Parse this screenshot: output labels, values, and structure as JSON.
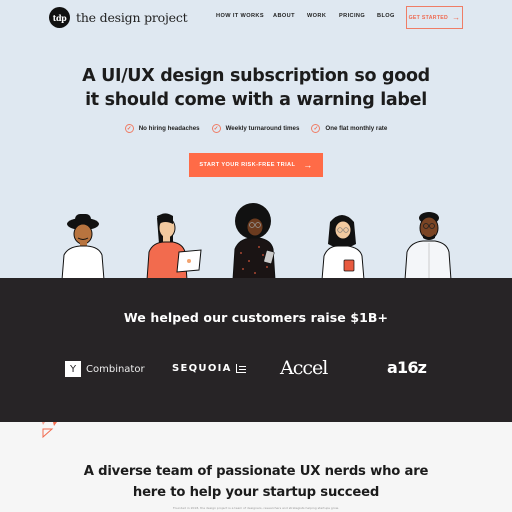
{
  "header": {
    "logo_mark": "tdp",
    "logo_text": "the design project",
    "nav": [
      "HOW IT WORKS",
      "ABOUT",
      "WORK",
      "PRICING",
      "BLOG"
    ],
    "cta_label": "GET STARTED",
    "cta_icon": "arrow-right-icon"
  },
  "hero": {
    "headline_line1": "A UI/UX design subscription so good",
    "headline_line2": "it should come with a warning label",
    "features": [
      "No hiring headaches",
      "Weekly turnaround times",
      "One flat monthly rate"
    ],
    "feature_icon": "check-circle-icon",
    "trial_label": "START YOUR RISK-FREE TRIAL",
    "trial_icon": "arrow-right-icon"
  },
  "social_proof": {
    "title": "We helped our customers raise $1B+",
    "logos": [
      {
        "name": "Y Combinator",
        "mark": "Y",
        "text": "Combinator"
      },
      {
        "name": "Sequoia",
        "text": "SEQUOIA"
      },
      {
        "name": "Accel",
        "text": "Accel"
      },
      {
        "name": "a16z",
        "text": "a16z"
      }
    ]
  },
  "team": {
    "title_line1": "A diverse team of passionate UX nerds who are",
    "title_line2": "here to help your startup succeed",
    "subtitle": "Founded in 2018, the design project is a team of designers, researchers and strategists helping startups grow."
  },
  "colors": {
    "accent": "#ff6b47",
    "hero_bg": "#dfe8f1",
    "band_bg": "#272426",
    "page_bg": "#f6f6f6"
  }
}
